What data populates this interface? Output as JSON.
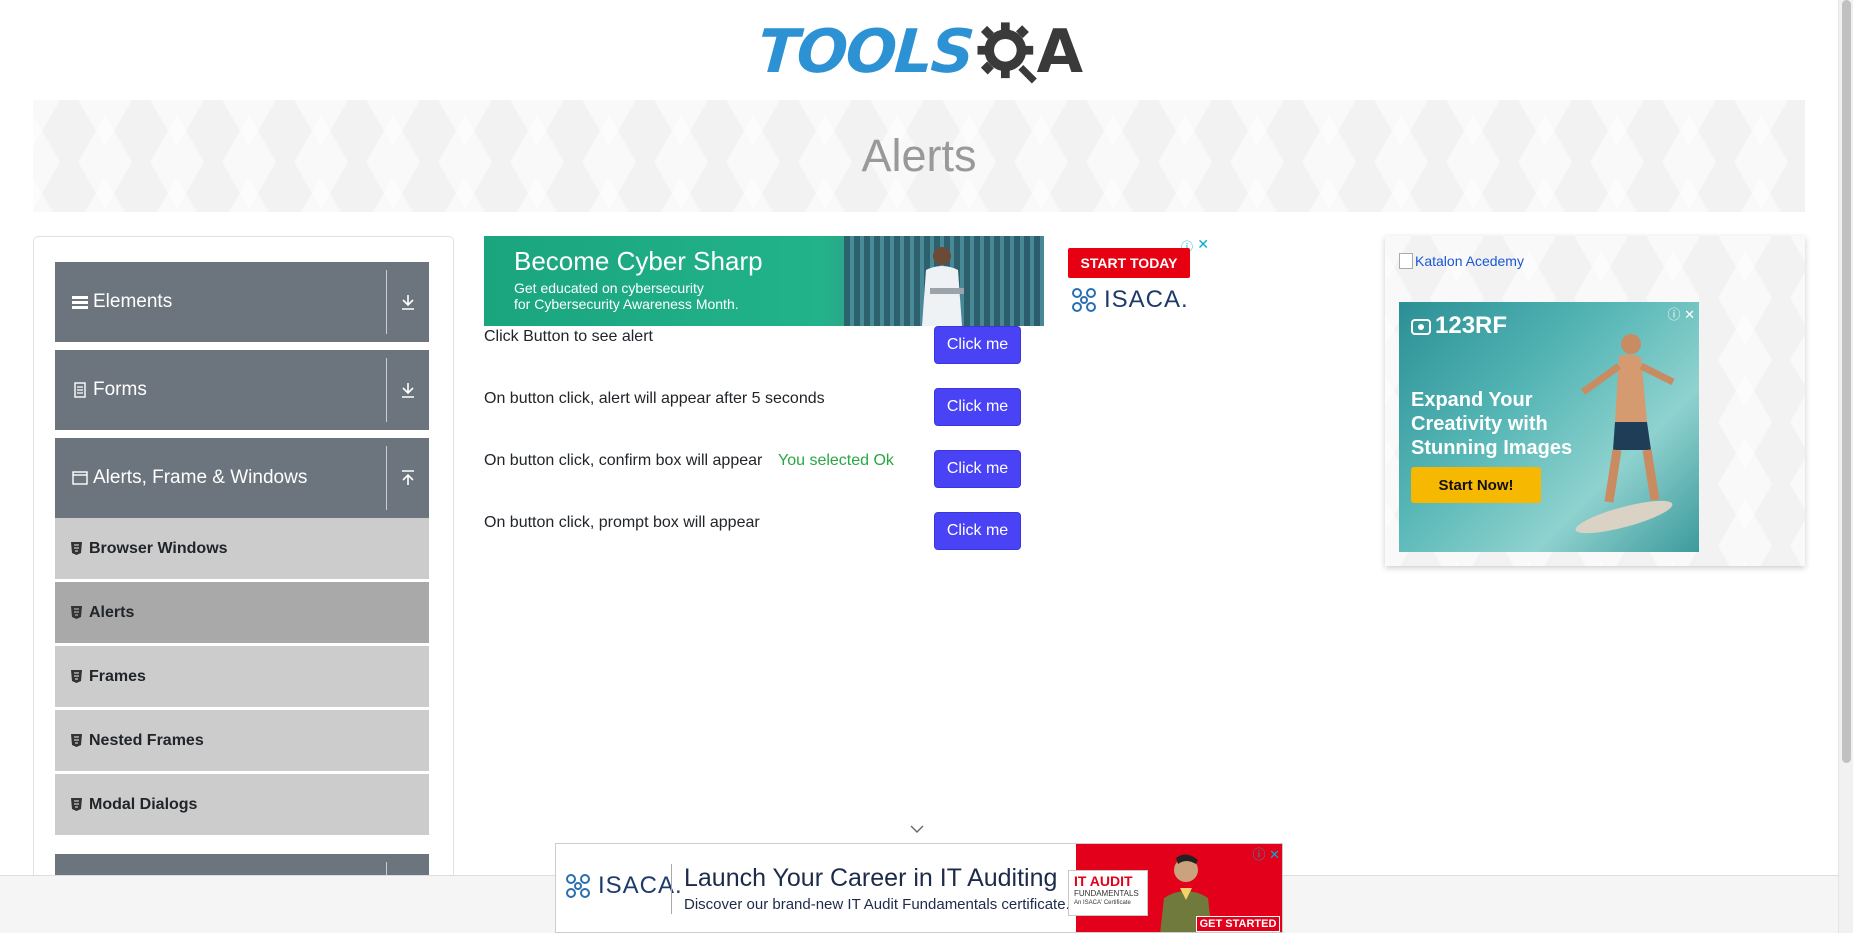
{
  "header": {
    "logo_text": "TOOLS",
    "logo_suffix": "A",
    "logo_name": "TOOLSQA"
  },
  "banner": {
    "title": "Alerts"
  },
  "sidebar": {
    "groups": [
      {
        "label": "Elements",
        "icon": "list-icon",
        "state": "collapsed"
      },
      {
        "label": "Forms",
        "icon": "document-icon",
        "state": "collapsed"
      },
      {
        "label": "Alerts, Frame & Windows",
        "icon": "window-icon",
        "state": "expanded"
      }
    ],
    "items": [
      {
        "label": "Browser Windows",
        "active": false
      },
      {
        "label": "Alerts",
        "active": true
      },
      {
        "label": "Frames",
        "active": false
      },
      {
        "label": "Nested Frames",
        "active": false
      },
      {
        "label": "Modal Dialogs",
        "active": false
      }
    ]
  },
  "ads": {
    "top": {
      "headline": "Become Cyber Sharp",
      "sub1": "Get educated on cybersecurity",
      "sub2": "for Cybersecurity Awareness Month.",
      "cta": "START TODAY",
      "brand": "ISACA."
    },
    "right": {
      "broken_image_alt": "Katalon Acedemy",
      "logo": "123RF",
      "text": "Expand Your Creativity with Stunning Images",
      "cta": "Start Now!"
    },
    "bottom": {
      "brand": "ISACA.",
      "headline": "Launch Your Career in IT Auditing",
      "sub": "Discover our brand-new IT Audit Fundamentals certificate.",
      "card_title": "IT AUDIT",
      "card_sub": "FUNDAMENTALS",
      "card_note": "An ISACA' Certificate",
      "cta": "GET STARTED"
    }
  },
  "alerts": {
    "rows": [
      {
        "label": "Click Button to see alert",
        "button": "Click me"
      },
      {
        "label": "On button click, alert will appear after 5 seconds",
        "button": "Click me"
      },
      {
        "label": "On button click, confirm box will appear",
        "button": "Click me",
        "result": "You selected Ok"
      },
      {
        "label": "On button click, prompt box will appear",
        "button": "Click me"
      }
    ]
  },
  "colors": {
    "primary_button": "#4943f5",
    "sidebar_group": "#6c757d",
    "sidebar_item": "#cccccc",
    "sidebar_item_active": "#a9a9a9",
    "success_text": "#28a745",
    "logo_blue": "#2c92d3"
  }
}
